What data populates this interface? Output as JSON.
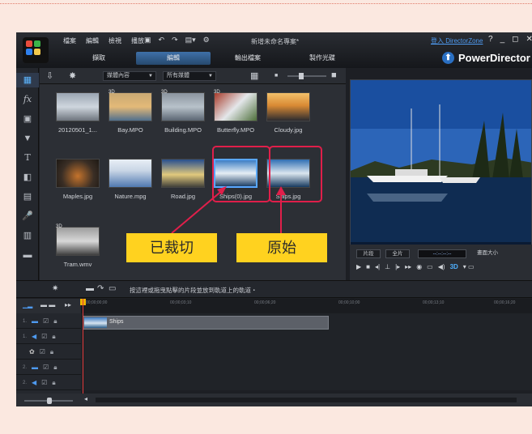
{
  "app": {
    "menu": [
      "檔案",
      "編輯",
      "檢視",
      "播放"
    ],
    "project_name": "新增未命名專案*",
    "sign_in": "登入 DirectorZone",
    "window_controls": [
      "?",
      "_",
      "◻",
      "✕"
    ],
    "modes": [
      "擷取",
      "編輯",
      "輸出檔案",
      "製作光碟"
    ],
    "active_mode": "編輯",
    "brand": "PowerDirector"
  },
  "library": {
    "filter_label": "媒體內容",
    "sort_label": "所有媒體",
    "items": [
      {
        "name": "20120501_1...",
        "badge": "",
        "colors": [
          "#9aa5b2",
          "#cfd6de",
          "#6d747d"
        ]
      },
      {
        "name": "Bay.MPO",
        "badge": "3D",
        "colors": [
          "#c9a873",
          "#e3b978",
          "#4f6f8d"
        ]
      },
      {
        "name": "Building.MPO",
        "badge": "3D",
        "colors": [
          "#8b949f",
          "#b8c2ca",
          "#5a6572"
        ]
      },
      {
        "name": "Butterfly.MPO",
        "badge": "3D",
        "colors": [
          "#a83c2c",
          "#e4e7ea",
          "#4d6f3a"
        ]
      },
      {
        "name": "Cloudy.jpg",
        "badge": "",
        "colors": [
          "#f3c16a",
          "#d98a34",
          "#2b2b30"
        ]
      },
      {
        "name": "Maples.jpg",
        "badge": "",
        "colors": [
          "#3a2e25",
          "#c4732c",
          "#1e1914"
        ]
      },
      {
        "name": "Nature.mpg",
        "badge": "",
        "colors": [
          "#c9d6e6",
          "#5079b0",
          "#e8eef5"
        ]
      },
      {
        "name": "Road.jpg",
        "badge": "",
        "colors": [
          "#274f8f",
          "#e1c97d",
          "#40403a"
        ]
      },
      {
        "name": "Ships(0).jpg",
        "badge": "",
        "colors": [
          "#3e7fc5",
          "#e6eef5",
          "#1e3f66"
        ]
      },
      {
        "name": "Ships.jpg",
        "badge": "",
        "colors": [
          "#2f6fb3",
          "#dbe6ef",
          "#173a5f"
        ]
      },
      {
        "name": "Tram.wmv",
        "badge": "3D",
        "colors": [
          "#9c9c9c",
          "#d8d8d8",
          "#3e3e3e"
        ]
      }
    ]
  },
  "preview": {
    "mode_clip": "片段",
    "mode_full": "全片",
    "timecode": "--:--:--:--",
    "view_size": "畫面大小",
    "volume_level": "3D"
  },
  "hint": "按這裡或拖曳點擊的片段並放到軌道上的軌道・",
  "timeline": {
    "ruler_marks": [
      "00;00;00;00",
      "00;00;03;10",
      "00;00;06;20",
      "00;00;10;00",
      "00;00;13;10",
      "00;00;16;20",
      "00;00;20;00"
    ],
    "clip_label": "Ships",
    "tracks": [
      {
        "num": "1.",
        "type": "video"
      },
      {
        "num": "1.",
        "type": "audio"
      },
      {
        "num": "",
        "type": "fx"
      },
      {
        "num": "2.",
        "type": "video"
      },
      {
        "num": "2.",
        "type": "audio"
      }
    ]
  },
  "annotations": {
    "cropped": "已裁切",
    "original": "原始",
    "box_color": "#e01f4a",
    "callout_color": "#ffd21f"
  }
}
